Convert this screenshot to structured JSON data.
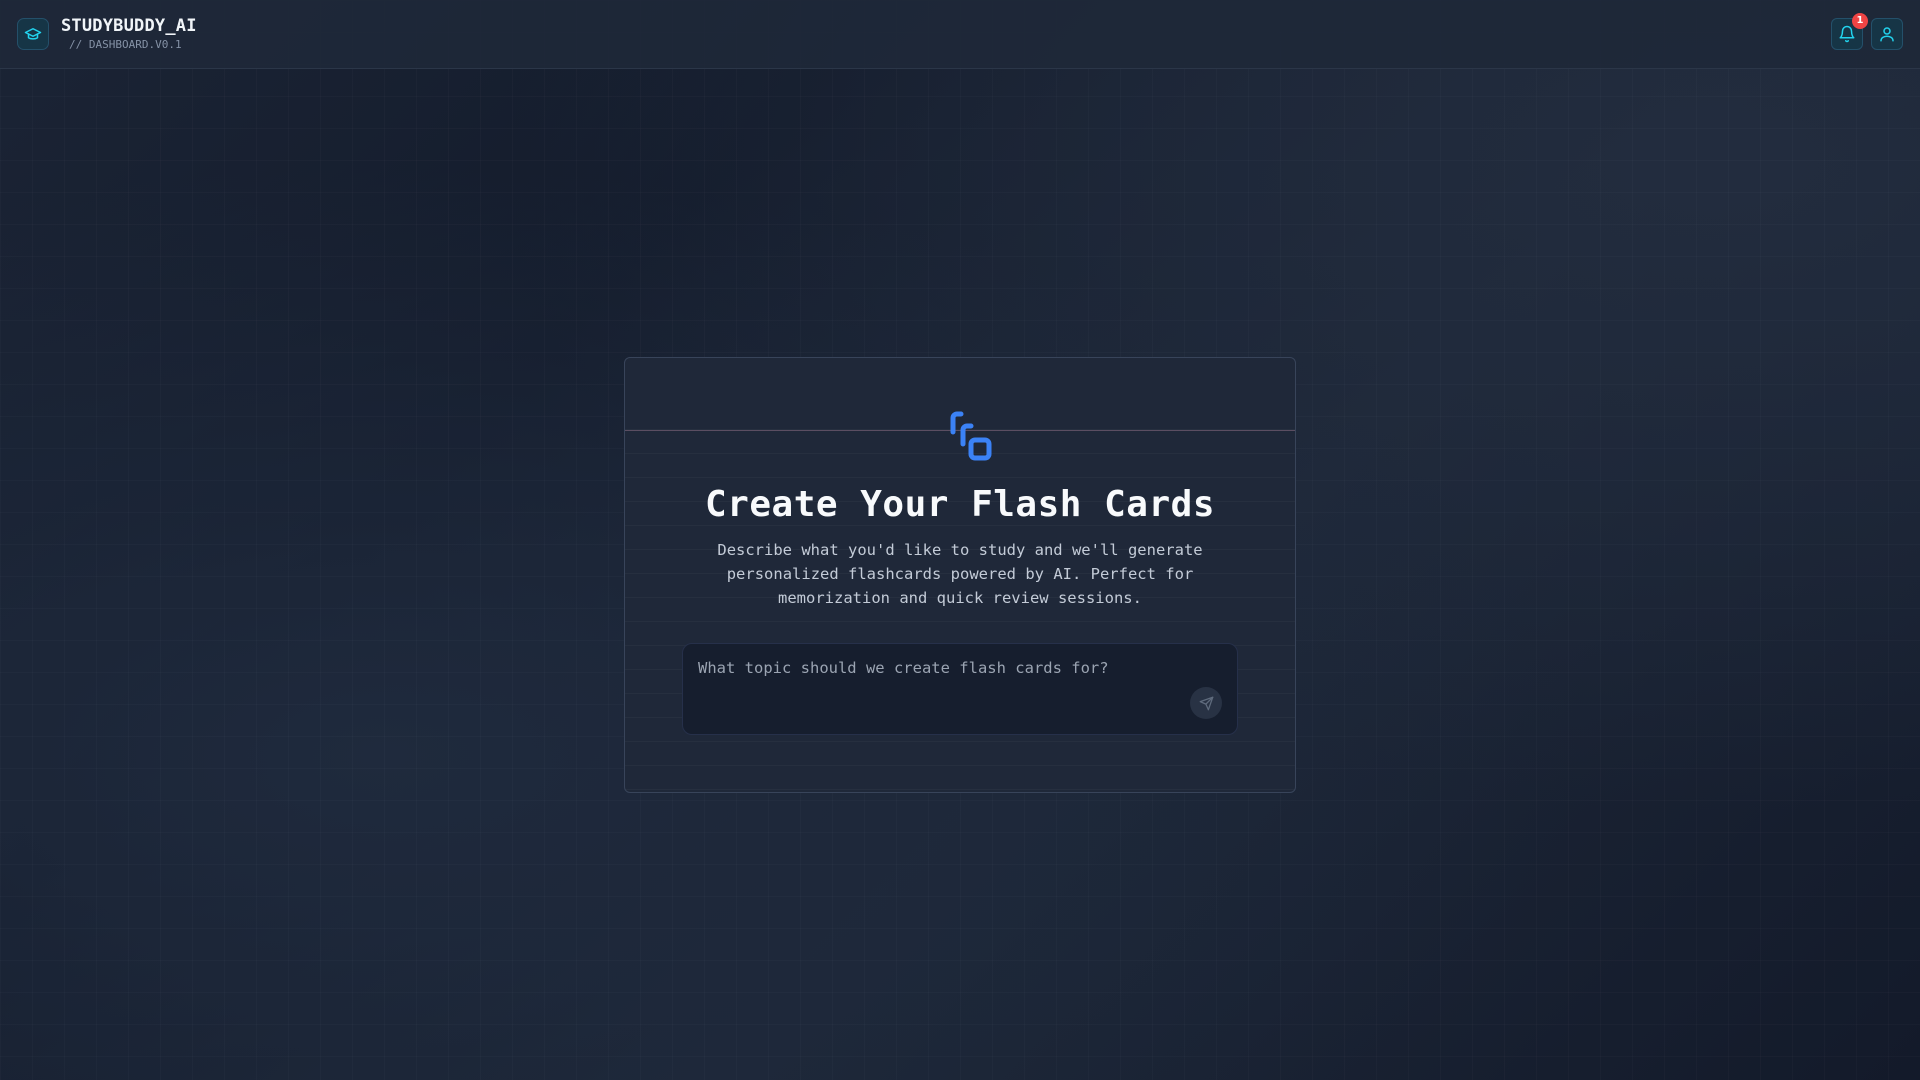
{
  "header": {
    "app_title": "STUDYBUDDY_AI",
    "subtitle": "// DASHBOARD.V0.1",
    "logo_icon": "graduation-cap-icon",
    "notification_icon": "bell-icon",
    "notification_count": "1",
    "profile_icon": "user-icon"
  },
  "card": {
    "icon": "flashcards-icon",
    "title": "Create Your Flash Cards",
    "description": "Describe what you'd like to study and we'll generate personalized flashcards powered by AI. Perfect for memorization and quick review sessions.",
    "input": {
      "value": "",
      "placeholder": "What topic should we create flash cards for?"
    },
    "send_icon": "send-icon"
  },
  "colors": {
    "accent": "#3b82f6",
    "cyan_accent": "#22d3ee",
    "badge": "#ef4444",
    "background": "#171f2f"
  }
}
